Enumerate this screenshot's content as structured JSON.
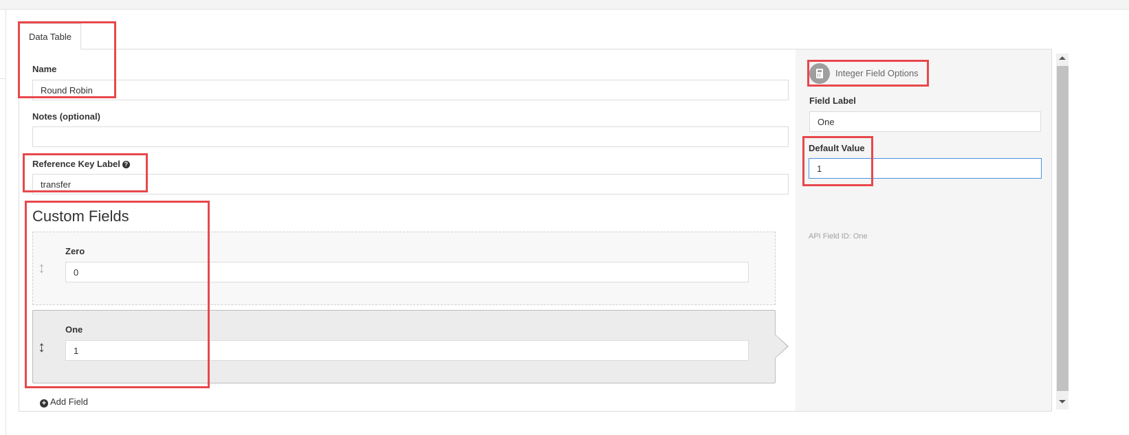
{
  "tabs": [
    {
      "label": "Data Table"
    }
  ],
  "form": {
    "name_label": "Name",
    "name_value": "Round Robin",
    "notes_label": "Notes (optional)",
    "notes_value": "",
    "ref_key_label": "Reference Key Label",
    "ref_key_value": "transfer",
    "help_glyph": "?"
  },
  "custom_fields": {
    "title": "Custom Fields",
    "items": [
      {
        "label": "Zero",
        "value": "0"
      },
      {
        "label": "One",
        "value": "1"
      }
    ],
    "add_field_label": "Add Field",
    "add_glyph": "+"
  },
  "field_options": {
    "title": "Integer Field Options",
    "icon": "calculator-icon",
    "field_label_label": "Field Label",
    "field_label_value": "One",
    "default_value_label": "Default Value",
    "default_value_value": "1",
    "api_field_id": "API Field ID: One"
  },
  "colors": {
    "highlight": "#e8474b",
    "focus_border": "#4a90e2",
    "sidebar_bg": "#f5f5f5"
  }
}
